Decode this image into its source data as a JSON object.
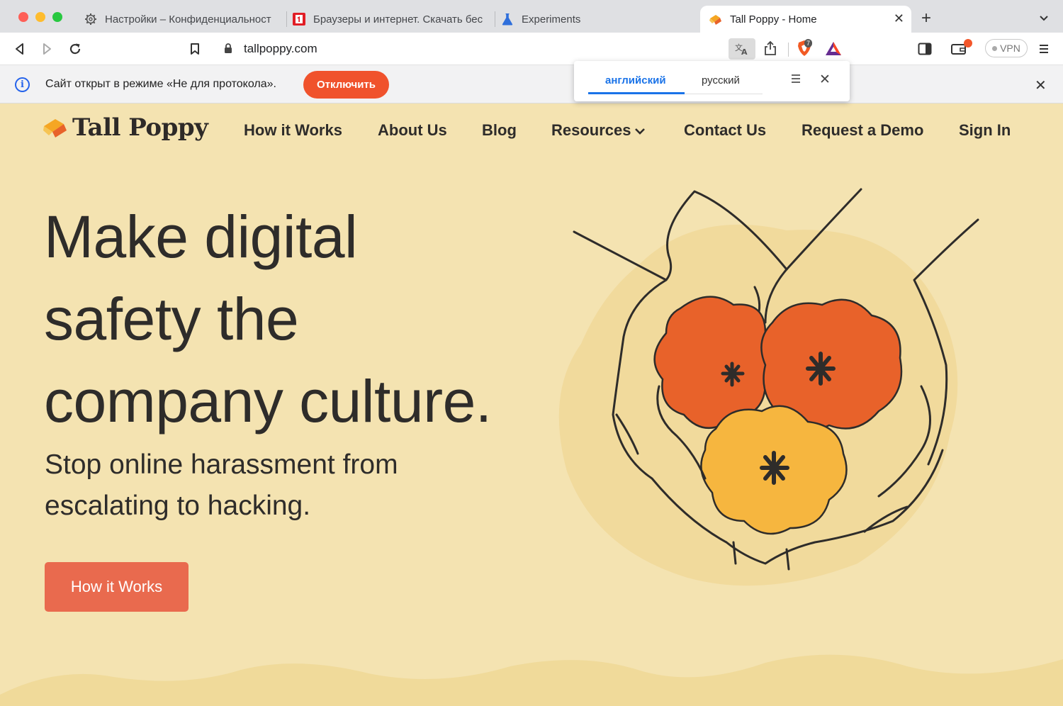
{
  "browser": {
    "tabs": [
      {
        "title": "Настройки – Конфиденциальност",
        "icon": "gear-icon"
      },
      {
        "title": "Браузеры и интернет. Скачать бес",
        "icon": "softportal-icon"
      },
      {
        "title": "Experiments",
        "icon": "flask-icon"
      },
      {
        "title": "Tall Poppy - Home",
        "icon": "tallpoppy-icon",
        "active": true
      }
    ],
    "url": "tallpoppy.com",
    "shield_count": "7",
    "vpn_label": "VPN"
  },
  "infobar": {
    "message": "Сайт открыт в режиме «Не для протокола».",
    "button_label": "Отключить"
  },
  "translate_popup": {
    "source_lang": "английский",
    "target_lang": "русский"
  },
  "site": {
    "logo_text": "Tall Poppy",
    "nav": [
      {
        "label": "How it Works"
      },
      {
        "label": "About Us"
      },
      {
        "label": "Blog"
      },
      {
        "label": "Resources",
        "has_dropdown": true
      },
      {
        "label": "Contact Us"
      },
      {
        "label": "Request a Demo"
      },
      {
        "label": "Sign In"
      }
    ],
    "hero": {
      "title_lines": [
        "Make digital",
        "safety the",
        "company culture."
      ],
      "subtitle_lines": [
        "Stop online harassment from",
        "escalating to hacking."
      ],
      "cta_label": "How it Works"
    }
  },
  "colors": {
    "page_background": "#f4e3b1",
    "accent_orange": "#f0522c",
    "cta_button": "#e96a4e",
    "flower_orange": "#e8622a",
    "flower_yellow": "#f6b63f",
    "text_dark": "#2e2c2a"
  }
}
